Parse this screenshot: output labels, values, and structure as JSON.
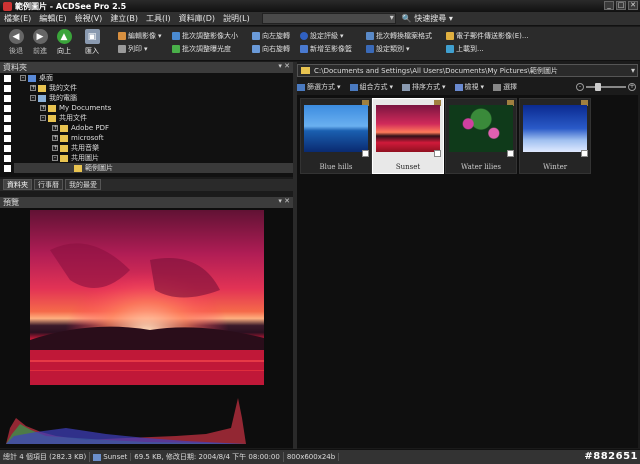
{
  "window": {
    "title": "範例圖片 - ACDSee Pro 2.5"
  },
  "menu": {
    "items": [
      "檔案(E)",
      "編輯(E)",
      "檢視(V)",
      "建立(B)",
      "工具(I)",
      "資料庫(D)",
      "說明(L)"
    ],
    "quick_search": "快速搜尋"
  },
  "toolbar": {
    "back": "後退",
    "forward": "前進",
    "up": "向上",
    "import": "匯入",
    "tools": [
      "編輯影像",
      "批次調整影像大小",
      "向左旋轉",
      "設定評級",
      "批次轉換檔案格式",
      "電子郵件傳送影像(E)...",
      "列印",
      "批次調整曝光度",
      "向右旋轉",
      "新增至影像籃",
      "設定類別",
      "上載到..."
    ]
  },
  "folders": {
    "header": "資料夾",
    "pin": "▾ ✕",
    "tree": [
      {
        "label": "桌面",
        "level": 0
      },
      {
        "label": "我的文件",
        "level": 1
      },
      {
        "label": "我的電腦",
        "level": 1
      },
      {
        "label": "My Documents",
        "level": 2
      },
      {
        "label": "共用文件",
        "level": 2
      },
      {
        "label": "Adobe PDF",
        "level": 3
      },
      {
        "label": "microsoft",
        "level": 3
      },
      {
        "label": "共用音樂",
        "level": 3
      },
      {
        "label": "共用圖片",
        "level": 3
      },
      {
        "label": "範例圖片",
        "level": 4
      }
    ],
    "tabs": [
      "資料夾",
      "行事曆",
      "我的最愛"
    ]
  },
  "preview": {
    "header": "預覽"
  },
  "address": {
    "path": "C:\\Documents and Settings\\All Users\\Documents\\My Pictures\\範例圖片"
  },
  "filebar": {
    "filter": "篩選方式",
    "group": "組合方式",
    "sort": "排序方式",
    "view": "檢視",
    "select": "選擇"
  },
  "thumbnails": [
    {
      "name": "Blue hills",
      "selected": false,
      "colors": [
        "#1a5fb0",
        "#3c8ce0",
        "#0a2a70"
      ]
    },
    {
      "name": "Sunset",
      "selected": true,
      "colors": [
        "#c0206a",
        "#ff5a4a",
        "#301018"
      ]
    },
    {
      "name": "Water lilies",
      "selected": false,
      "colors": [
        "#1a4a1a",
        "#d040a0",
        "#0a2a0a"
      ]
    },
    {
      "name": "Winter",
      "selected": false,
      "colors": [
        "#0a2a90",
        "#3a6ad8",
        "#e0eaff"
      ]
    }
  ],
  "status": {
    "total": "總計 4 個項目 (282.3 KB)",
    "file": "Sunset",
    "info": "69.5 KB, 修改日期: 2004/8/4 下午 08:00:00",
    "dims": "800x600x24b"
  },
  "watermark": "#882651"
}
